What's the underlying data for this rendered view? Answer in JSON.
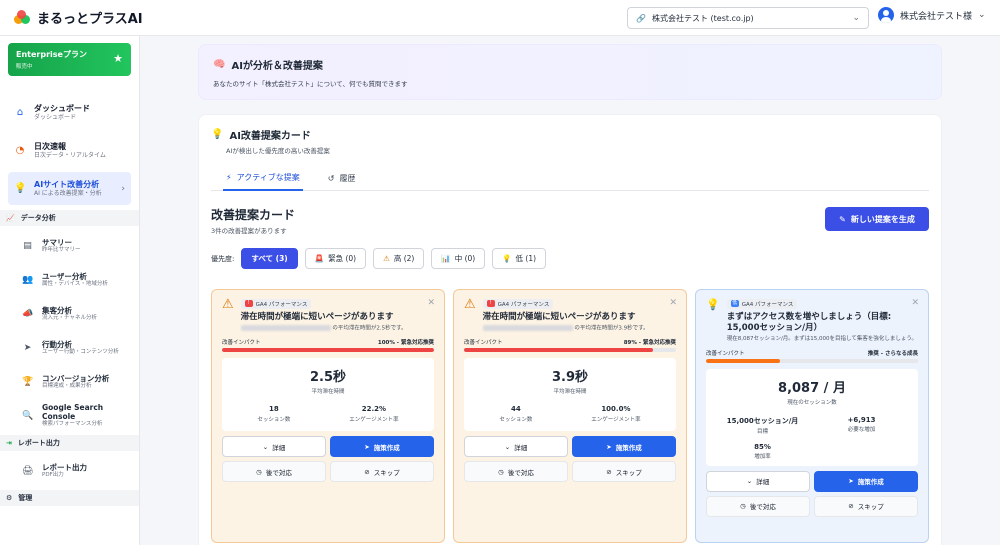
{
  "app": {
    "name": "まるっとプラスAI"
  },
  "site_selector": {
    "value": "株式会社テスト (test.co.jp)"
  },
  "user": {
    "name": "株式会社テスト様"
  },
  "plan": {
    "name": "Enterpriseプラン",
    "sub": "販売中"
  },
  "nav": [
    {
      "label": "ダッシュボード",
      "sub": "ダッシュボード"
    },
    {
      "label": "日次速報",
      "sub": "日次データ・リアルタイム"
    },
    {
      "label": "AIサイト改善分析",
      "sub": "AI による改善提案・分析"
    }
  ],
  "sections": {
    "analysis": "データ分析",
    "report": "レポート出力",
    "admin": "管理"
  },
  "analysis_items": [
    {
      "label": "サマリー",
      "sub": "昨年比サマリー"
    },
    {
      "label": "ユーザー分析",
      "sub": "属性・デバイス・地域分析"
    },
    {
      "label": "集客分析",
      "sub": "流入元・チャネル分析"
    },
    {
      "label": "行動分析",
      "sub": "ユーザー行動・コンテンツ分析"
    },
    {
      "label": "コンバージョン分析",
      "sub": "目標達成・成果分析"
    },
    {
      "label": "Google Search Console",
      "sub": "検索パフォーマンス分析"
    }
  ],
  "report_items": [
    {
      "label": "レポート出力",
      "sub": "PDF出力"
    }
  ],
  "hero": {
    "title": "AIが分析＆改善提案",
    "subtitle": "あなたのサイト「株式会社テスト」について、何でも質問できます"
  },
  "panel": {
    "title": "AI改善提案カード",
    "subtitle": "AIが検出した優先度の高い改善提案"
  },
  "tabs": [
    {
      "label": "アクティブな提案"
    },
    {
      "label": "履歴"
    }
  ],
  "cards_section": {
    "title": "改善提案カード",
    "count_text": "3件の改善提案があります",
    "generate_label": "新しい提案を生成"
  },
  "filters": {
    "label": "優先度:",
    "chips": [
      {
        "label": "すべて (3)"
      },
      {
        "label": "緊急 (0)"
      },
      {
        "label": "高 (2)"
      },
      {
        "label": "中 (0)"
      },
      {
        "label": "低 (1)"
      }
    ]
  },
  "colors": {
    "urgent_bar": "#ef4444",
    "low_bar": "#f97316",
    "primary": "#2563eb"
  },
  "cards": [
    {
      "category": "GA4 パフォーマンス",
      "title": "滞在時間が極端に短いページがあります",
      "desc": "の平均滞在時間が2.5秒です。",
      "impact_label": "改善インパクト",
      "impact_value": "100% - 緊急対応推奨",
      "impact_pct": 1.0,
      "metric_value": "2.5秒",
      "metric_label": "平均滞在時間",
      "stat1_value": "18",
      "stat1_label": "セッション数",
      "stat2_value": "22.2%",
      "stat2_label": "エンゲージメント率",
      "detail": "詳細",
      "create": "施策作成",
      "later": "後で対応",
      "skip": "スキップ"
    },
    {
      "category": "GA4 パフォーマンス",
      "title": "滞在時間が極端に短いページがあります",
      "desc": "の平均滞在時間が3.9秒です。",
      "impact_label": "改善インパクト",
      "impact_value": "89% - 緊急対応推奨",
      "impact_pct": 0.89,
      "metric_value": "3.9秒",
      "metric_label": "平均滞在時間",
      "stat1_value": "44",
      "stat1_label": "セッション数",
      "stat2_value": "100.0%",
      "stat2_label": "エンゲージメント率",
      "detail": "詳細",
      "create": "施策作成",
      "later": "後で対応",
      "skip": "スキップ"
    },
    {
      "priority": "低",
      "category": "GA4 パフォーマンス",
      "title": "まずはアクセス数を増やしましょう（目標: 15,000セッション/月）",
      "desc": "現在8,087セッション/月。まずは15,000を目指して集客を強化しましょう。",
      "impact_label": "改善インパクト",
      "impact_value": "推奨 - さらなる成長",
      "impact_pct": 0.35,
      "metric_value": "8,087 / 月",
      "metric_label": "現在のセッション数",
      "goal_value": "15,000セッション/月",
      "goal_label": "目標",
      "need_value": "+6,913",
      "need_label": "必要な増加",
      "rate_value": "85%",
      "rate_label": "増加率",
      "detail": "詳細",
      "create": "施策作成",
      "later": "後で対応",
      "skip": "スキップ"
    }
  ]
}
